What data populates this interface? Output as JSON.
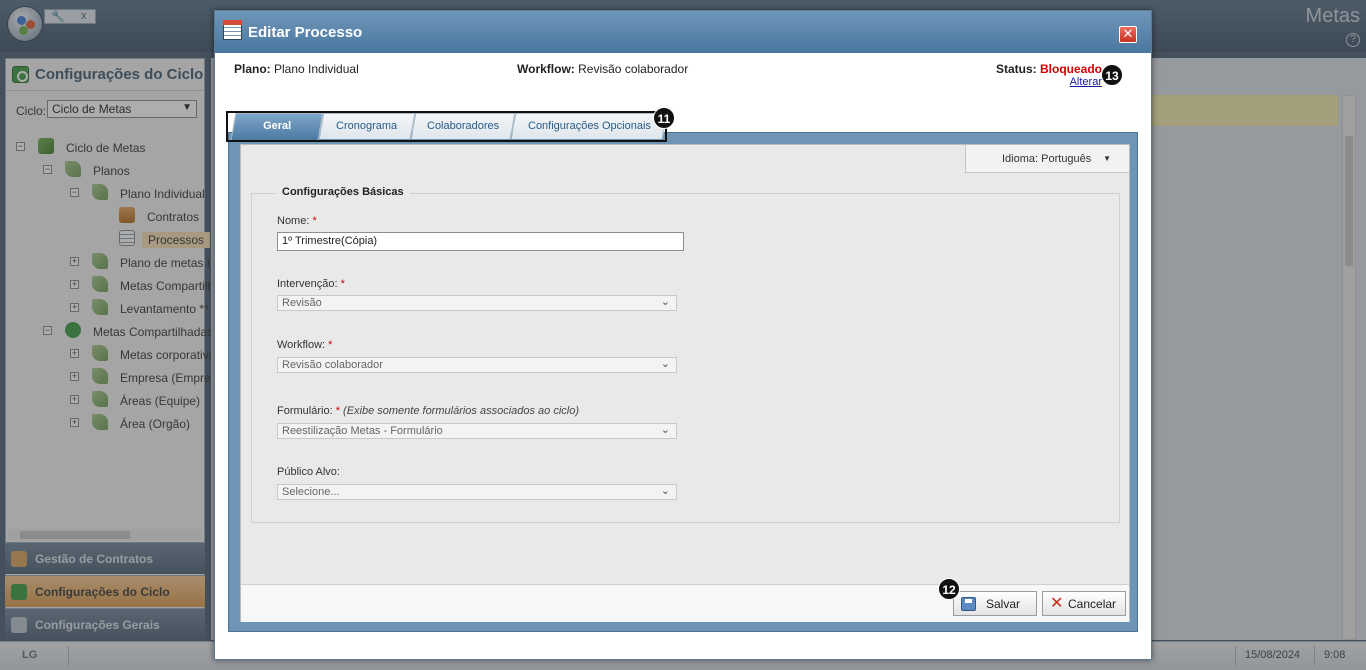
{
  "app": {
    "title": "Metas",
    "help_icon": "question-icon",
    "tools_label": "x"
  },
  "sidebar": {
    "title": "Configurações do Ciclo",
    "cycle_label": "Ciclo:",
    "cycle_value": "Ciclo de Metas",
    "tree": [
      {
        "label": "Ciclo de Metas",
        "expander": "⊟"
      },
      {
        "label": "Planos",
        "expander": "⊟"
      },
      {
        "label": "Plano Individual",
        "expander": "⊟"
      },
      {
        "label": "Contratos",
        "expander": ""
      },
      {
        "label": "Processos",
        "expander": ""
      },
      {
        "label": "Plano de metas I",
        "expander": "⊞"
      },
      {
        "label": "Metas Compartilh",
        "expander": "⊞"
      },
      {
        "label": "Levantamento **",
        "expander": "⊞"
      },
      {
        "label": "Metas Compartilhadas",
        "expander": "⊟"
      },
      {
        "label": "Metas corporativa",
        "expander": "⊞"
      },
      {
        "label": "Empresa (Empres",
        "expander": "⊞"
      },
      {
        "label": "Áreas (Equipe)",
        "expander": "⊞"
      },
      {
        "label": "Área (Orgão)",
        "expander": "⊞"
      }
    ],
    "accordion": [
      {
        "label": "Gestão de Contratos"
      },
      {
        "label": "Configurações do Ciclo"
      },
      {
        "label": "Configurações Gerais"
      }
    ]
  },
  "statusbar": {
    "logo": "LG",
    "date": "15/08/2024",
    "time": "9:08"
  },
  "dialog": {
    "title": "Editar Processo",
    "close_label": "✕",
    "plano_label": "Plano:",
    "plano_value": "Plano Individual",
    "workflow_label": "Workflow:",
    "workflow_value": "Revisão colaborador",
    "status_label": "Status:",
    "status_value": "Bloqueado",
    "alterar_link": "Alterar",
    "tabs": [
      {
        "label": "Geral"
      },
      {
        "label": "Cronograma"
      },
      {
        "label": "Colaboradores"
      },
      {
        "label": "Configurações Opcionais"
      }
    ],
    "language": {
      "label": "Idioma:",
      "value": "Português"
    },
    "section_title": "Configurações Básicas",
    "fields": {
      "nome": {
        "label": "Nome:",
        "value": "1º Trimestre(Cópia)"
      },
      "intervencao": {
        "label": "Intervenção:",
        "value": "Revisão"
      },
      "workflow": {
        "label": "Workflow:",
        "value": "Revisão colaborador"
      },
      "formulario": {
        "label": "Formulário:",
        "note": "(Exibe somente formulários associados ao ciclo)",
        "value": "Reestilização Metas - Formulário"
      },
      "publico": {
        "label": "Público Alvo:",
        "value": "Selecione..."
      }
    },
    "required_mark": "*",
    "save_label": "Salvar",
    "cancel_label": "Cancelar"
  },
  "annotations": {
    "badge_tabs": "11",
    "badge_save": "12",
    "badge_status": "13"
  }
}
